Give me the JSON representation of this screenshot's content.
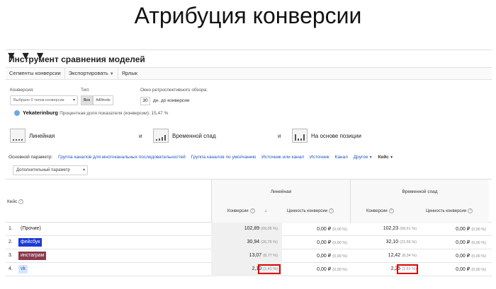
{
  "slide_title": "Атрибуция конверсии",
  "tool_title": "Инструмент сравнения моделей",
  "toolbar": {
    "segments": "Сегменты конверсии",
    "export": "Экспортировать",
    "shortcut": "Ярлык"
  },
  "filters": {
    "conversion_label": "Конверсия:",
    "conversion_value": "Выбрано 0 типов конверсии",
    "type_label": "Тип:",
    "type_all": "Все",
    "type_adwords": "AdWords",
    "lookback_label": "Окно ретроспективного обзора:",
    "lookback_value": "30",
    "lookback_suffix": "дн. до конверсии"
  },
  "city": {
    "name": "Yekaterinburg",
    "share_text": "Процентная доля показателя (конверсии): 15,47 %"
  },
  "models": [
    {
      "name": "Линейная"
    },
    {
      "name": "Временной спад"
    },
    {
      "name": "На основе позиции"
    }
  ],
  "and_word": "и",
  "params": {
    "label": "Основной параметр:",
    "links": [
      "Группа каналов для многоканальных последовательностей",
      "Группа каналов по умолчанию",
      "Источник или канал",
      "Источник",
      "Канал",
      "Другое"
    ],
    "current": "Кейс"
  },
  "additional_param": "Дополнительный параметр",
  "table": {
    "first_col": "Кейс",
    "groups": [
      {
        "title": "Линейная",
        "conv": "Конверсии",
        "value": "Ценность конверсии"
      },
      {
        "title": "Временной спад",
        "conv": "Конверсии",
        "value": "Ценность конверсии"
      }
    ],
    "rows": [
      {
        "idx": "1.",
        "name": "(Прочие)",
        "tag_color": "",
        "c1": "102,89",
        "p1": "(69,05 %)",
        "v1": "0,00 ₽",
        "vp1": "(0,00 %)",
        "c2": "102,23",
        "p2": "(68,61 %)",
        "v2": "0,00 ₽",
        "vp2": "(0,00 %)"
      },
      {
        "idx": "2.",
        "name": "фейсбук",
        "tag_color": "#1a3bd4",
        "c1": "30,94",
        "p1": "(20,76 %)",
        "v1": "0,00 ₽",
        "vp1": "(0,00 %)",
        "c2": "32,10",
        "p2": "(21,55 %)",
        "v2": "0,00 ₽",
        "vp2": "(0,00 %)"
      },
      {
        "idx": "3.",
        "name": "инстаграм",
        "tag_color": "#8a3a4e",
        "c1": "13,07",
        "p1": "(8,77 %)",
        "v1": "0,00 ₽",
        "vp1": "(0,00 %)",
        "c2": "12,42",
        "p2": "(8,34 %)",
        "v2": "0,00 ₽",
        "vp2": "(0,00 %)"
      },
      {
        "idx": "4.",
        "name": "vk",
        "tag_color": "#d7e6fa",
        "c1": "2,10",
        "p1": "(1,41 %)",
        "v1": "0,00 ₽",
        "vp1": "(0,00 %)",
        "c2": "2,25",
        "p2": "(1,51 %)",
        "v2": "0,00 ₽",
        "vp2": "(0,00 %)"
      }
    ]
  },
  "colors": {
    "highlight": "#e00000",
    "link": "#1a55c4"
  }
}
